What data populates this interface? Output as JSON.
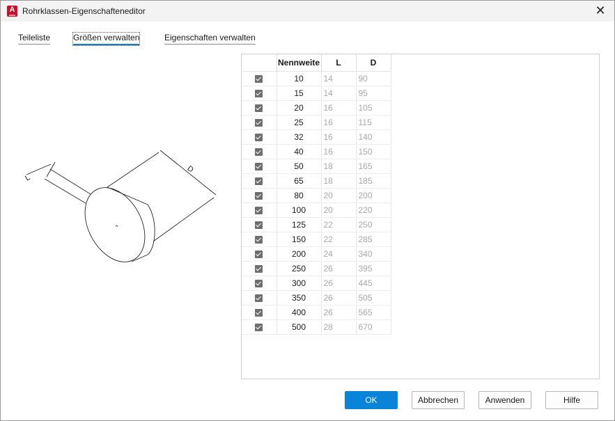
{
  "window": {
    "title": "Rohrklassen-Eigenschafteneditor",
    "app_icon_letter": "A",
    "close_glyph": "✕"
  },
  "tabs": [
    {
      "label": "Teileliste"
    },
    {
      "label": "Größen verwalten",
      "active": true
    },
    {
      "label": "Eigenschaften verwalten"
    }
  ],
  "drawing": {
    "dimension_labels": {
      "length": "L",
      "diameter": "D"
    }
  },
  "grid": {
    "columns": [
      "",
      "Nennweite",
      "L",
      "D"
    ],
    "rows": [
      {
        "checked": true,
        "nennweite": "10",
        "l": "14",
        "d": "90"
      },
      {
        "checked": true,
        "nennweite": "15",
        "l": "14",
        "d": "95"
      },
      {
        "checked": true,
        "nennweite": "20",
        "l": "16",
        "d": "105"
      },
      {
        "checked": true,
        "nennweite": "25",
        "l": "16",
        "d": "115"
      },
      {
        "checked": true,
        "nennweite": "32",
        "l": "16",
        "d": "140"
      },
      {
        "checked": true,
        "nennweite": "40",
        "l": "16",
        "d": "150"
      },
      {
        "checked": true,
        "nennweite": "50",
        "l": "18",
        "d": "165"
      },
      {
        "checked": true,
        "nennweite": "65",
        "l": "18",
        "d": "185"
      },
      {
        "checked": true,
        "nennweite": "80",
        "l": "20",
        "d": "200"
      },
      {
        "checked": true,
        "nennweite": "100",
        "l": "20",
        "d": "220"
      },
      {
        "checked": true,
        "nennweite": "125",
        "l": "22",
        "d": "250"
      },
      {
        "checked": true,
        "nennweite": "150",
        "l": "22",
        "d": "285"
      },
      {
        "checked": true,
        "nennweite": "200",
        "l": "24",
        "d": "340"
      },
      {
        "checked": true,
        "nennweite": "250",
        "l": "26",
        "d": "395"
      },
      {
        "checked": true,
        "nennweite": "300",
        "l": "26",
        "d": "445"
      },
      {
        "checked": true,
        "nennweite": "350",
        "l": "26",
        "d": "505"
      },
      {
        "checked": true,
        "nennweite": "400",
        "l": "26",
        "d": "565"
      },
      {
        "checked": true,
        "nennweite": "500",
        "l": "28",
        "d": "670"
      }
    ]
  },
  "buttons": {
    "ok": "OK",
    "cancel": "Abbrechen",
    "apply": "Anwenden",
    "help": "Hilfe"
  },
  "colors": {
    "accent": "#0a84d8",
    "brand": "#c8102e"
  }
}
